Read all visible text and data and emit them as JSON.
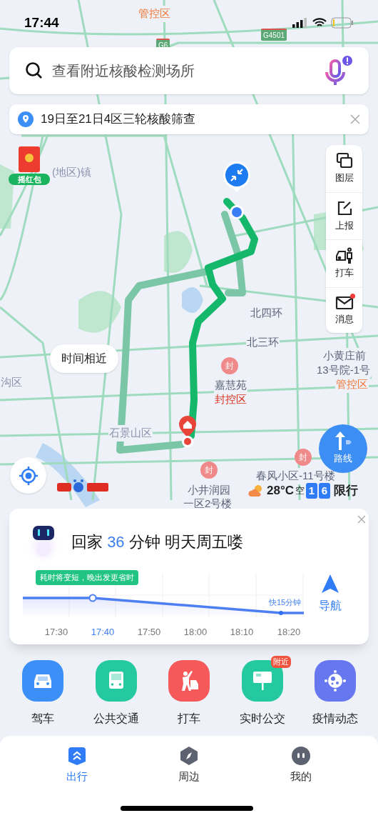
{
  "status_bar": {
    "time": "17:44"
  },
  "search": {
    "placeholder": "查看附近核酸检测场所"
  },
  "notice": {
    "text": "19日至21日4区三轮核酸筛查"
  },
  "red_packet": {
    "label": "摇红包"
  },
  "map_tools": [
    {
      "kind": "layers",
      "label": "图层",
      "dot": false
    },
    {
      "kind": "report",
      "label": "上报",
      "dot": false
    },
    {
      "kind": "taxi",
      "label": "打车",
      "dot": false
    },
    {
      "kind": "message",
      "label": "消息",
      "dot": true
    }
  ],
  "map_labels": [
    {
      "text": "管控区",
      "color": "#f07a3c"
    },
    {
      "text": "(地区)镇",
      "color": "#8a93ab"
    },
    {
      "text": "北四环",
      "color": "#5a6378"
    },
    {
      "text": "北三环",
      "color": "#5a6378"
    },
    {
      "text": "小黄庄前",
      "color": "#5a6378"
    },
    {
      "text": "13号院-1号",
      "color": "#5a6378"
    },
    {
      "text": "沟区",
      "color": "#8a93ab"
    },
    {
      "text": "嘉慧苑",
      "color": "#5a6378"
    },
    {
      "text": "管控区",
      "color": "#f07a3c"
    },
    {
      "text": "封控区",
      "color": "#d9301c"
    },
    {
      "text": "石景山区",
      "color": "#8a93ab"
    },
    {
      "text": "春风小区-11号楼",
      "color": "#5a6378"
    },
    {
      "text": "小井润园",
      "color": "#5a6378"
    },
    {
      "text": "一区2号楼",
      "color": "#5a6378"
    }
  ],
  "road_shields": [
    "G6",
    "G4501"
  ],
  "map_pins": [
    "封",
    "封",
    "封"
  ],
  "route_bubble": "时间相近",
  "route_button": {
    "label": "路线"
  },
  "weather": {
    "temperature": "28°C",
    "air": "空",
    "plates": [
      "1",
      "6"
    ],
    "restriction": "限行"
  },
  "trip_card": {
    "prefix": "回家",
    "minutes": "36",
    "suffix": "分钟 明天周五喽",
    "tip": "耗时将变短，晚出发更省时",
    "saving": "快15分钟",
    "times": [
      {
        "label": "17:30",
        "selected": false
      },
      {
        "label": "17:40",
        "selected": true
      },
      {
        "label": "17:50",
        "selected": false
      },
      {
        "label": "18:00",
        "selected": false
      },
      {
        "label": "18:10",
        "selected": false
      },
      {
        "label": "18:20",
        "selected": false
      }
    ],
    "nav_button": "导航"
  },
  "quick_actions": [
    {
      "kind": "car",
      "label": "驾车",
      "color": "#3b8ff6"
    },
    {
      "kind": "bus",
      "label": "公共交通",
      "color": "#25c9a0"
    },
    {
      "kind": "taxi",
      "label": "打车",
      "color": "#f5595a"
    },
    {
      "kind": "stop",
      "label": "实时公交",
      "color": "#25c9a0",
      "badge": "附近"
    },
    {
      "kind": "virus",
      "label": "疫情动态",
      "color": "#6677f0"
    }
  ],
  "tabs": [
    {
      "kind": "travel",
      "label": "出行",
      "selected": true
    },
    {
      "kind": "nearby",
      "label": "周边",
      "selected": false
    },
    {
      "kind": "me",
      "label": "我的",
      "selected": false
    }
  ]
}
